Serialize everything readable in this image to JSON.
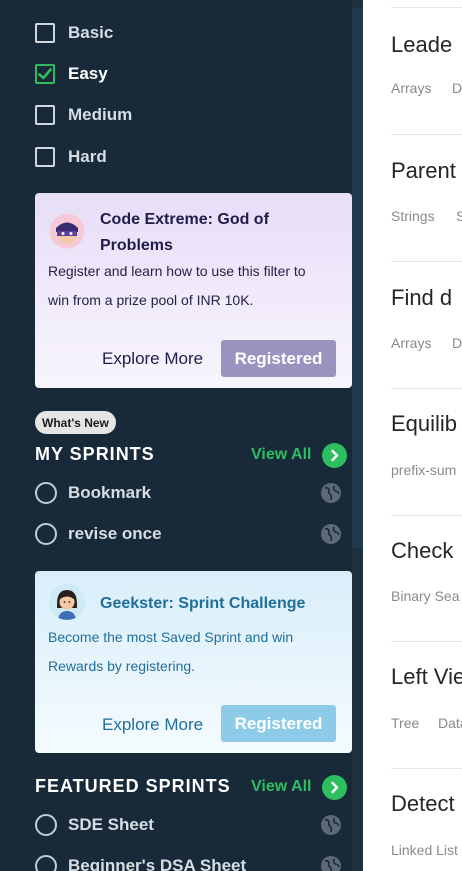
{
  "difficulty": {
    "items": [
      {
        "label": "Basic",
        "checked": false
      },
      {
        "label": "Easy",
        "checked": true
      },
      {
        "label": "Medium",
        "checked": false
      },
      {
        "label": "Hard",
        "checked": false
      }
    ]
  },
  "promo_contest": {
    "title_line1": "Code Extreme: God of",
    "title_line2": "Problems",
    "desc_line1": "Register and learn how to use this filter to",
    "desc_line2": "win from a prize pool of INR 10K.",
    "explore_label": "Explore More",
    "registered_label": "Registered"
  },
  "badge": {
    "whats_new": "What's New"
  },
  "my_sprints": {
    "title": "MY SPRINTS",
    "view_all": "View All",
    "items": [
      {
        "label": "Bookmark"
      },
      {
        "label": "revise once"
      }
    ]
  },
  "promo_sprint": {
    "title": "Geekster: Sprint Challenge",
    "desc_line1": "Become the most Saved Sprint and win",
    "desc_line2": "Rewards by registering.",
    "explore_label": "Explore More",
    "registered_label": "Registered"
  },
  "featured_sprints": {
    "title": "FEATURED SPRINTS",
    "view_all": "View All",
    "items": [
      {
        "label": "SDE Sheet"
      },
      {
        "label": "Beginner's DSA Sheet"
      }
    ]
  },
  "problems": [
    {
      "title": "Leade",
      "tags": [
        "Arrays",
        "D"
      ]
    },
    {
      "title": "Parent",
      "tags": [
        "Strings",
        "S"
      ]
    },
    {
      "title": "Find d",
      "tags": [
        "Arrays",
        "D"
      ]
    },
    {
      "title": "Equilib",
      "tags": [
        "prefix-sum"
      ]
    },
    {
      "title": "Check",
      "tags": [
        "Binary Sea"
      ]
    },
    {
      "title": "Left Vie",
      "tags": [
        "Tree",
        "Data"
      ]
    },
    {
      "title": "Detect",
      "tags": [
        "Linked List"
      ]
    }
  ],
  "colors": {
    "sidebar_bg": "#18293a",
    "accent_green": "#2dbe60",
    "contest_button": "#9a93bf",
    "sprint_button": "#8ecbe8",
    "sprint_text": "#1f6f9a"
  }
}
